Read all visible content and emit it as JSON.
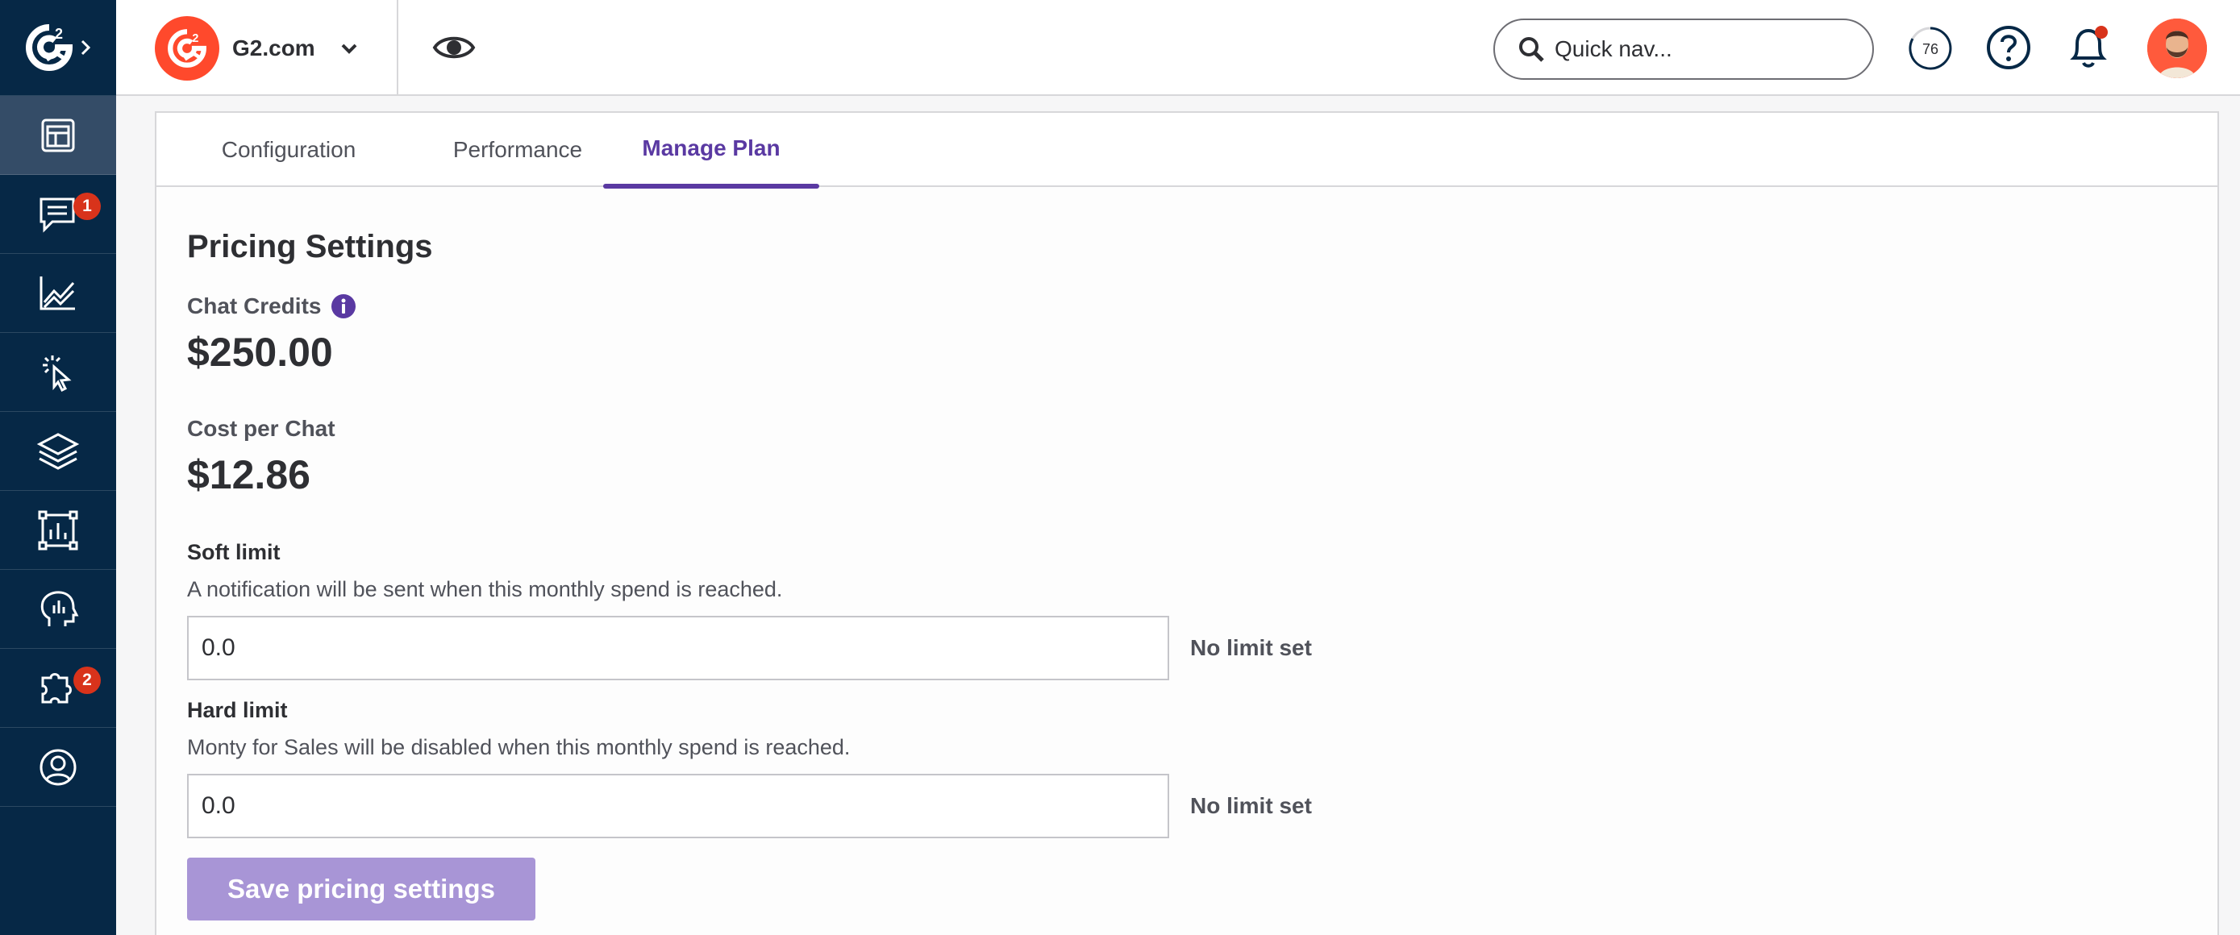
{
  "sidebar": {
    "items": [
      {
        "icon": "dashboard-icon",
        "active": true,
        "badge": null
      },
      {
        "icon": "chat-icon",
        "active": false,
        "badge": "1"
      },
      {
        "icon": "analytics-icon",
        "active": false,
        "badge": null
      },
      {
        "icon": "click-cursor-icon",
        "active": false,
        "badge": null
      },
      {
        "icon": "layers-icon",
        "active": false,
        "badge": null
      },
      {
        "icon": "report-icon",
        "active": false,
        "badge": null
      },
      {
        "icon": "head-insights-icon",
        "active": false,
        "badge": null
      },
      {
        "icon": "integrations-icon",
        "active": false,
        "badge": "2"
      },
      {
        "icon": "profile-icon",
        "active": false,
        "badge": null
      }
    ]
  },
  "topbar": {
    "product_name": "G2.com",
    "search_placeholder": "Quick nav...",
    "score": "76"
  },
  "tabs": [
    {
      "label": "Configuration",
      "active": false
    },
    {
      "label": "Performance",
      "active": false
    },
    {
      "label": "Manage Plan",
      "active": true
    }
  ],
  "pricing": {
    "title": "Pricing Settings",
    "chat_credits_label": "Chat Credits",
    "chat_credits_value": "$250.00",
    "cost_per_chat_label": "Cost per Chat",
    "cost_per_chat_value": "$12.86",
    "soft_limit": {
      "label": "Soft limit",
      "help": "A notification will be sent when this monthly spend is reached.",
      "value": "0.0",
      "note": "No limit set"
    },
    "hard_limit": {
      "label": "Hard limit",
      "help": "Monty for Sales will be disabled when this monthly spend is reached.",
      "value": "0.0",
      "note": "No limit set"
    },
    "save_label": "Save pricing settings"
  },
  "colors": {
    "nav_bg": "#062846",
    "accent_purple": "#5a39a2",
    "brand_orange": "#ff492c",
    "badge_red": "#d8331b",
    "button_disabled": "#a895d6"
  }
}
